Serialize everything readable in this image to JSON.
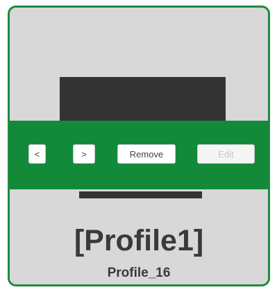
{
  "toolbar": {
    "prev_label": "<",
    "next_label": ">",
    "remove_label": "Remove",
    "edit_label": "Edit"
  },
  "profile": {
    "name": "[Profile1]",
    "id": "Profile_16"
  },
  "colors": {
    "accent": "#128a3a",
    "border": "#1e8a3e",
    "card_background": "#d8d8d8",
    "preview_block": "#333333"
  },
  "state": {
    "edit_enabled": false
  }
}
